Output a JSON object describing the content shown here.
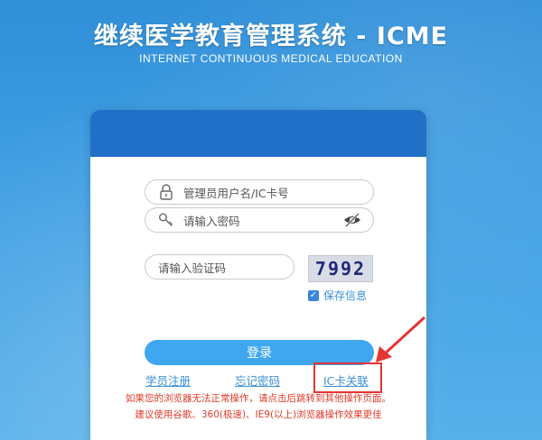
{
  "header": {
    "title": "继续医学教育管理系统 - ICME",
    "subtitle": "INTERNET CONTINUOUS MEDICAL EDUCATION"
  },
  "form": {
    "username_placeholder": "管理员用户名/IC卡号",
    "password_placeholder": "请输入密码",
    "captcha_placeholder": "请输入验证码",
    "captcha_text": "7992",
    "remember_label": "保存信息",
    "remember_checked": true,
    "login_label": "登录"
  },
  "links": {
    "register": "学员注册",
    "forgot": "忘记密码",
    "ic_link": "IC卡关联"
  },
  "notices": {
    "line1": "如果您的浏览器无法正常操作，请点击后跳转到其他操作页面。",
    "line2": "建议使用谷歌、360(极速)、IE9(以上)浏览器操作效果更佳"
  },
  "colors": {
    "background": "#3f9ee2",
    "card_header": "#2170c8",
    "login_button": "#3fa7ef",
    "link": "#3a8fd8",
    "notice_red": "#e23a2a",
    "highlight": "#e53434"
  },
  "icons": {
    "username": "lock-icon",
    "password": "key-icon",
    "toggle_password": "eye-slash-icon",
    "pointer": "red-arrow-icon"
  }
}
